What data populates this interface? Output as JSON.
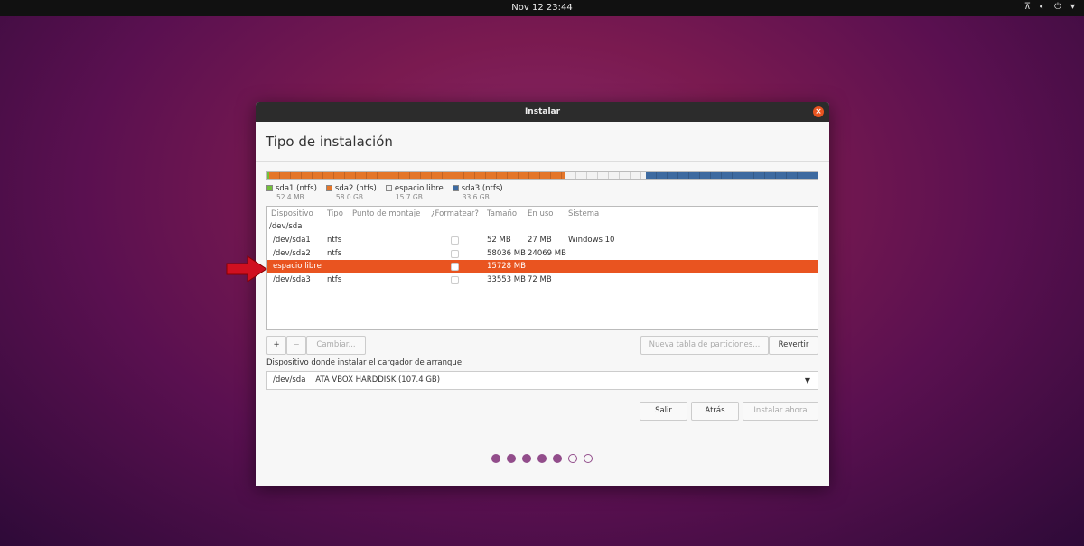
{
  "topbar": {
    "clock": "Nov 12  23:44",
    "icons": [
      "network-icon",
      "volume-icon",
      "power-icon",
      "menu-down-icon"
    ]
  },
  "window": {
    "title": "Instalar",
    "heading": "Tipo de instalación"
  },
  "partition_bar": [
    {
      "name": "sda1 (ntfs)",
      "size": "52.4 MB",
      "color": "#73c03a",
      "gb": 0.0524
    },
    {
      "name": "sda2 (ntfs)",
      "size": "58.0 GB",
      "color": "#e4762a",
      "gb": 58.0
    },
    {
      "name": "espacio libre",
      "size": "15.7 GB",
      "color": "#f2f2f2",
      "gb": 15.7
    },
    {
      "name": "sda3 (ntfs)",
      "size": "33.6 GB",
      "color": "#3d6aa0",
      "gb": 33.6
    }
  ],
  "table": {
    "headers": [
      "Dispositivo",
      "Tipo",
      "Punto de montaje",
      "¿Formatear?",
      "Tamaño",
      "En uso",
      "Sistema"
    ],
    "group": "/dev/sda",
    "rows": [
      {
        "device": "/dev/sda1",
        "type": "ntfs",
        "mount": "",
        "size": "52 MB",
        "used": "27 MB",
        "system": "Windows 10",
        "selected": false
      },
      {
        "device": "/dev/sda2",
        "type": "ntfs",
        "mount": "",
        "size": "58036 MB",
        "used": "24069 MB",
        "system": "",
        "selected": false
      },
      {
        "device": "espacio libre",
        "type": "",
        "mount": "",
        "size": "15728 MB",
        "used": "",
        "system": "",
        "selected": true
      },
      {
        "device": "/dev/sda3",
        "type": "ntfs",
        "mount": "",
        "size": "33553 MB",
        "used": "72 MB",
        "system": "",
        "selected": false
      }
    ]
  },
  "buttons": {
    "add": "+",
    "remove": "−",
    "change": "Cambiar...",
    "new_table": "Nueva tabla de particiones...",
    "revert": "Revertir",
    "quit": "Salir",
    "back": "Atrás",
    "install": "Instalar ahora"
  },
  "bootloader": {
    "label": "Dispositivo donde instalar el cargador de arranque:",
    "value": "/dev/sda    ATA VBOX HARDDISK (107.4 GB)"
  },
  "progress": {
    "total_steps": 7,
    "completed_steps": 5
  }
}
